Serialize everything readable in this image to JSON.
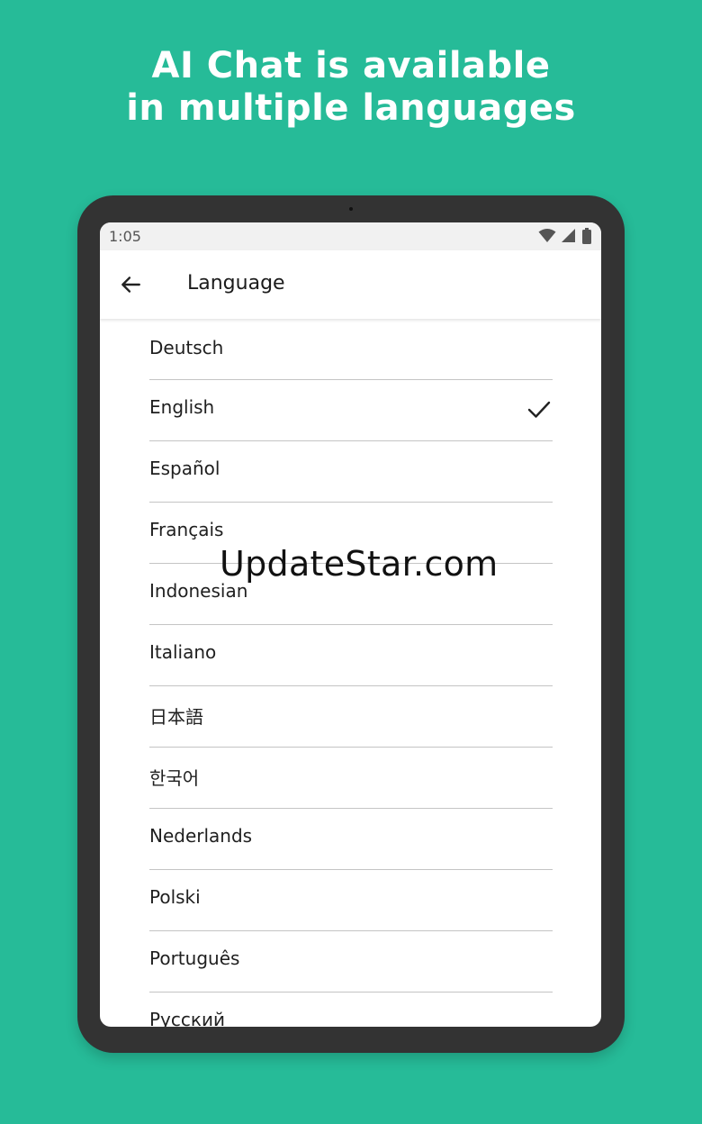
{
  "headline": {
    "line1": "AI Chat is available",
    "line2": "in multiple languages"
  },
  "status_bar": {
    "time": "1:05",
    "icons": [
      "wifi-icon",
      "signal-icon",
      "battery-icon"
    ]
  },
  "app_bar": {
    "back_icon": "arrow-left-icon",
    "title": "Language"
  },
  "languages": [
    {
      "label": "Deutsch",
      "selected": false
    },
    {
      "label": "English",
      "selected": true
    },
    {
      "label": "Español",
      "selected": false
    },
    {
      "label": "Français",
      "selected": false
    },
    {
      "label": "Indonesian",
      "selected": false
    },
    {
      "label": "Italiano",
      "selected": false
    },
    {
      "label": "日本語",
      "selected": false
    },
    {
      "label": "한국어",
      "selected": false
    },
    {
      "label": "Nederlands",
      "selected": false
    },
    {
      "label": "Polski",
      "selected": false
    },
    {
      "label": "Português",
      "selected": false
    },
    {
      "label": "Русский",
      "selected": false
    }
  ],
  "watermark": "UpdateStar.com",
  "colors": {
    "background": "#26bb98",
    "device_frame": "#333333",
    "screen": "#ffffff"
  }
}
